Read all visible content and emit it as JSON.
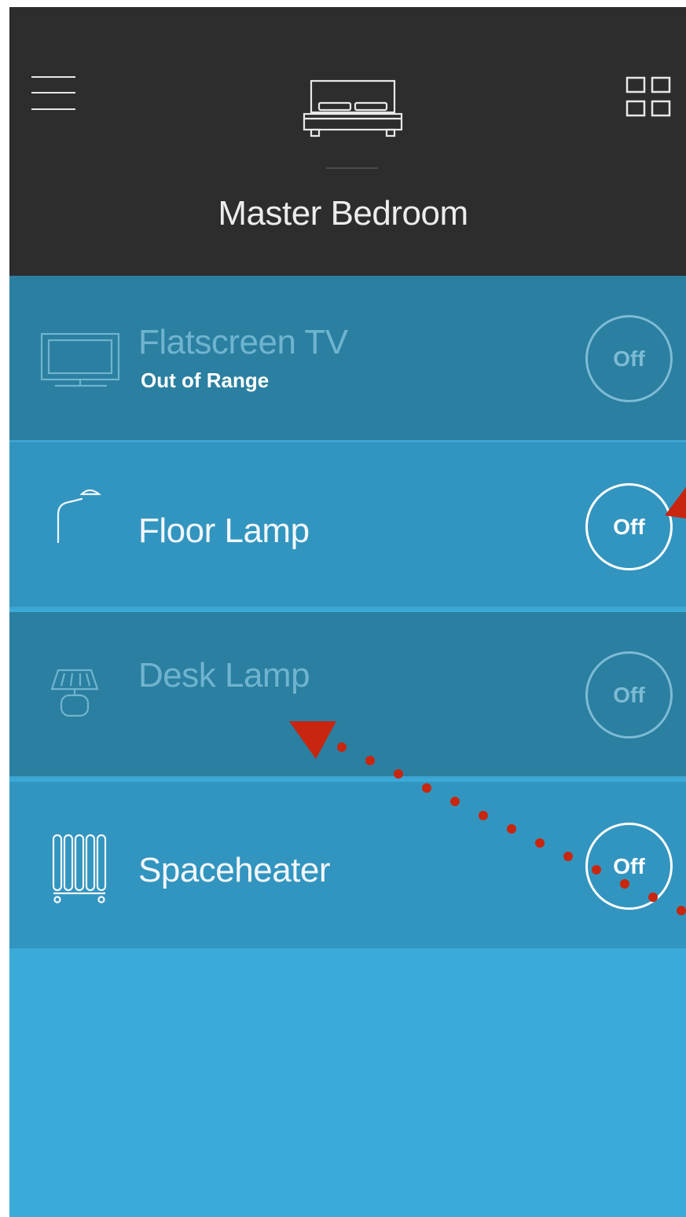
{
  "header": {
    "room_title": "Master Bedroom",
    "menu_icon": "hamburger-menu-icon",
    "room_icon": "bed-icon",
    "grid_icon": "grid-view-icon"
  },
  "devices": [
    {
      "name": "Flatscreen TV",
      "status": "Out of Range",
      "toggle": "Off",
      "icon": "tv-icon",
      "state": "unavailable"
    },
    {
      "name": "Floor Lamp",
      "status": "",
      "toggle": "Off",
      "icon": "floor-lamp-icon",
      "state": "available"
    },
    {
      "name": "Desk Lamp",
      "status": "",
      "toggle": "Off",
      "icon": "desk-lamp-icon",
      "state": "unavailable"
    },
    {
      "name": "Spaceheater",
      "status": "",
      "toggle": "Off",
      "icon": "space-heater-icon",
      "state": "available"
    }
  ],
  "colors": {
    "header_bg": "#2d2d2d",
    "row_dim": "#2b7fa0",
    "row_active": "#3295bf",
    "app_bg": "#3aabd8",
    "annotation_red": "#c8260f"
  }
}
